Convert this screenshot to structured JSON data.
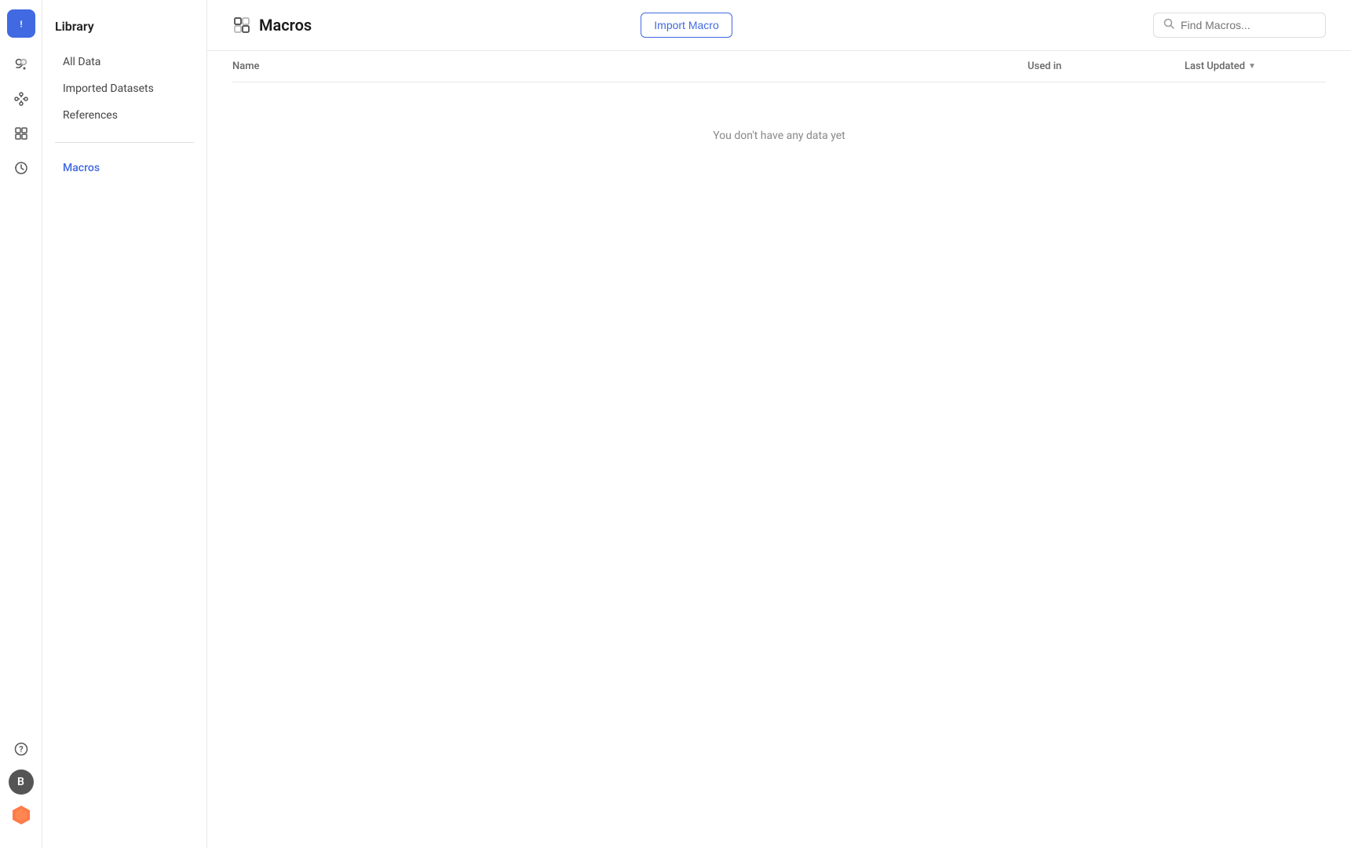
{
  "sidebar": {
    "title": "Library",
    "nav_items": [
      {
        "id": "all-data",
        "label": "All Data",
        "active": false
      },
      {
        "id": "imported-datasets",
        "label": "Imported Datasets",
        "active": false
      },
      {
        "id": "references",
        "label": "References",
        "active": false
      },
      {
        "id": "macros",
        "label": "Macros",
        "active": true
      }
    ]
  },
  "page": {
    "title": "Macros",
    "import_button_label": "Import Macro",
    "search_placeholder": "Find Macros...",
    "table": {
      "col_name": "Name",
      "col_used_in": "Used in",
      "col_last_updated": "Last Updated",
      "empty_message": "You don't have any data yet"
    }
  },
  "nav_rail": {
    "top_icon": "⬟",
    "icons": [
      {
        "id": "layers",
        "label": "layers-icon"
      },
      {
        "id": "nodes",
        "label": "nodes-icon"
      },
      {
        "id": "widgets",
        "label": "widgets-icon"
      },
      {
        "id": "history",
        "label": "history-icon"
      }
    ],
    "bottom_icons": [
      {
        "id": "help",
        "label": "help-icon"
      },
      {
        "id": "user",
        "label": "user-avatar",
        "letter": "B"
      },
      {
        "id": "gem",
        "label": "gem-icon"
      }
    ]
  }
}
